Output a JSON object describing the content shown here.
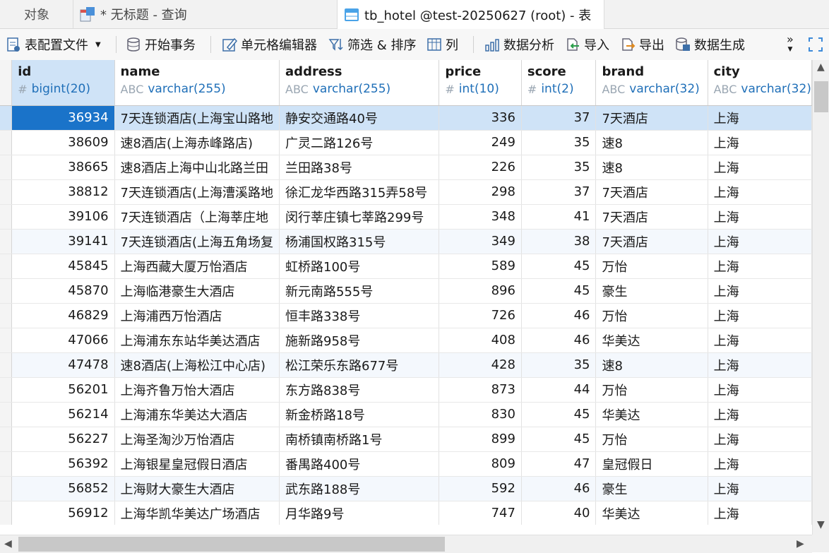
{
  "tabs": {
    "objects": "对象",
    "query": "* 无标题 - 查询",
    "table": "tb_hotel @test-20250627 (root) - 表"
  },
  "toolbar": {
    "config": "表配置文件",
    "begin_tx": "开始事务",
    "cell_editor": "单元格编辑器",
    "filter_sort": "筛选 & 排序",
    "columns": "列",
    "analyze": "数据分析",
    "import": "导入",
    "export": "导出",
    "generate": "数据生成",
    "more": "»"
  },
  "columns": [
    {
      "name": "id",
      "type": "bigint(20)",
      "icon": "#"
    },
    {
      "name": "name",
      "type": "varchar(255)",
      "icon": "ABC"
    },
    {
      "name": "address",
      "type": "varchar(255)",
      "icon": "ABC"
    },
    {
      "name": "price",
      "type": "int(10)",
      "icon": "#"
    },
    {
      "name": "score",
      "type": "int(2)",
      "icon": "#"
    },
    {
      "name": "brand",
      "type": "varchar(32)",
      "icon": "ABC"
    },
    {
      "name": "city",
      "type": "varchar(32)",
      "icon": "ABC"
    }
  ],
  "rows": [
    [
      "36934",
      "7天连锁酒店(上海宝山路地",
      "静安交通路40号",
      "336",
      "37",
      "7天酒店",
      "上海"
    ],
    [
      "38609",
      "速8酒店(上海赤峰路店)",
      "广灵二路126号",
      "249",
      "35",
      "速8",
      "上海"
    ],
    [
      "38665",
      "速8酒店上海中山北路兰田",
      "兰田路38号",
      "226",
      "35",
      "速8",
      "上海"
    ],
    [
      "38812",
      "7天连锁酒店(上海漕溪路地",
      "徐汇龙华西路315弄58号",
      "298",
      "37",
      "7天酒店",
      "上海"
    ],
    [
      "39106",
      "7天连锁酒店（上海莘庄地",
      "闵行莘庄镇七莘路299号",
      "348",
      "41",
      "7天酒店",
      "上海"
    ],
    [
      "39141",
      "7天连锁酒店(上海五角场复",
      "杨浦国权路315号",
      "349",
      "38",
      "7天酒店",
      "上海"
    ],
    [
      "45845",
      "上海西藏大厦万怡酒店",
      "虹桥路100号",
      "589",
      "45",
      "万怡",
      "上海"
    ],
    [
      "45870",
      "上海临港豪生大酒店",
      "新元南路555号",
      "896",
      "45",
      "豪生",
      "上海"
    ],
    [
      "46829",
      "上海浦西万怡酒店",
      "恒丰路338号",
      "726",
      "46",
      "万怡",
      "上海"
    ],
    [
      "47066",
      "上海浦东东站华美达酒店",
      "施新路958号",
      "408",
      "46",
      "华美达",
      "上海"
    ],
    [
      "47478",
      "速8酒店(上海松江中心店)",
      "松江荣乐东路677号",
      "428",
      "35",
      "速8",
      "上海"
    ],
    [
      "56201",
      "上海齐鲁万怡大酒店",
      "东方路838号",
      "873",
      "44",
      "万怡",
      "上海"
    ],
    [
      "56214",
      "上海浦东华美达大酒店",
      "新金桥路18号",
      "830",
      "45",
      "华美达",
      "上海"
    ],
    [
      "56227",
      "上海圣淘沙万怡酒店",
      "南桥镇南桥路1号",
      "899",
      "45",
      "万怡",
      "上海"
    ],
    [
      "56392",
      "上海银星皇冠假日酒店",
      "番禺路400号",
      "809",
      "47",
      "皇冠假日",
      "上海"
    ],
    [
      "56852",
      "上海财大豪生大酒店",
      "武东路188号",
      "592",
      "46",
      "豪生",
      "上海"
    ],
    [
      "56912",
      "上海华凯华美达广场酒店",
      "月华路9号",
      "747",
      "40",
      "华美达",
      "上海"
    ]
  ],
  "selected_row": 0,
  "colors": {
    "accent": "#1a73c9",
    "selection": "#cfe3f7",
    "type": "#1f6fb8"
  }
}
